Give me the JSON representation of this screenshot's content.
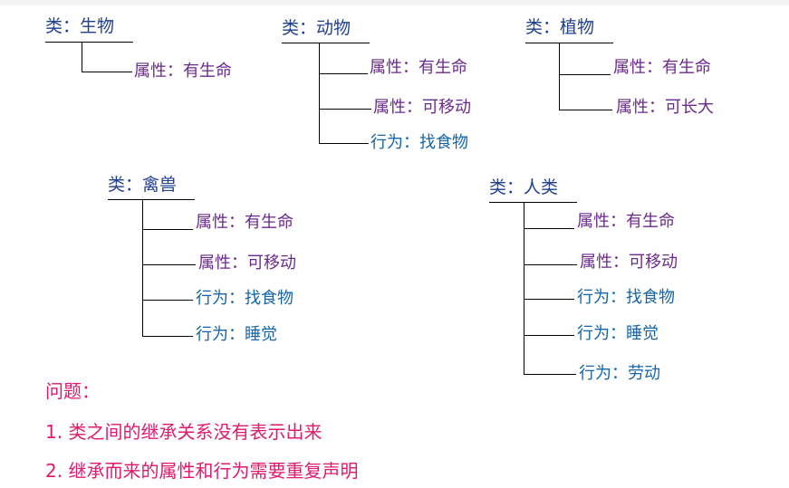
{
  "classes": [
    {
      "title": "类：生物",
      "members": [
        {
          "kind": "attr",
          "text": "属性：有生命"
        }
      ]
    },
    {
      "title": "类：动物",
      "members": [
        {
          "kind": "attr",
          "text": "属性：有生命"
        },
        {
          "kind": "attr",
          "text": "属性：可移动"
        },
        {
          "kind": "beh",
          "text": "行为：找食物"
        }
      ]
    },
    {
      "title": "类：植物",
      "members": [
        {
          "kind": "attr",
          "text": "属性：有生命"
        },
        {
          "kind": "attr",
          "text": "属性：可长大"
        }
      ]
    },
    {
      "title": "类：禽兽",
      "members": [
        {
          "kind": "attr",
          "text": "属性：有生命"
        },
        {
          "kind": "attr",
          "text": "属性：可移动"
        },
        {
          "kind": "beh",
          "text": "行为：找食物"
        },
        {
          "kind": "beh",
          "text": "行为：睡觉"
        }
      ]
    },
    {
      "title": "类：人类",
      "members": [
        {
          "kind": "attr",
          "text": "属性：有生命"
        },
        {
          "kind": "attr",
          "text": "属性：可移动"
        },
        {
          "kind": "beh",
          "text": "行为：找食物"
        },
        {
          "kind": "beh",
          "text": "行为：睡觉"
        },
        {
          "kind": "beh",
          "text": "行为：劳动"
        }
      ]
    }
  ],
  "questions": {
    "heading": "问题：",
    "items": [
      "1.  类之间的继承关系没有表示出来",
      "2.  继承而来的属性和行为需要重复声明"
    ]
  },
  "colors": {
    "class_title": "#1f3f8f",
    "attribute": "#6b2a8c",
    "behavior": "#1565a8",
    "question": "#e0196e",
    "line": "#000000"
  }
}
